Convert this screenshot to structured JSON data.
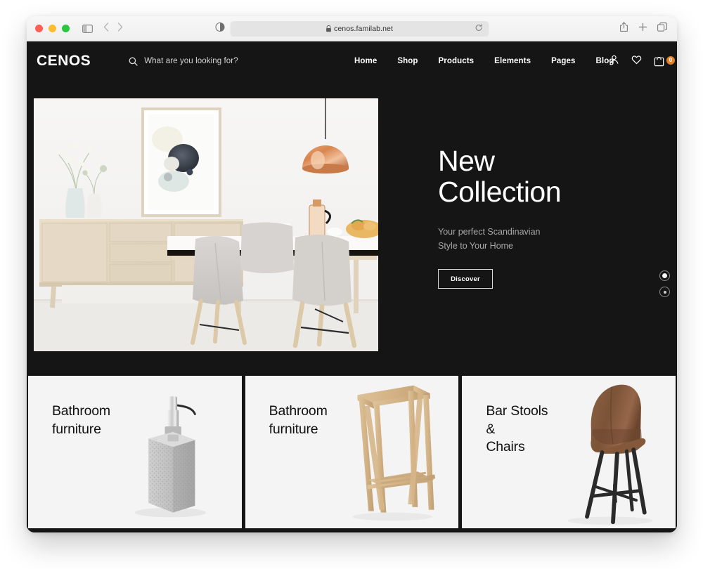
{
  "browser": {
    "url": "cenos.familab.net",
    "lock_icon": "lock-icon",
    "reload_icon": "reload-icon",
    "sidebar_icon": "sidebar-toggle-icon",
    "back_icon": "back-chevron-icon",
    "forward_icon": "forward-chevron-icon",
    "reader_icon": "reader-mode-icon",
    "share_icon": "share-icon",
    "newtab_icon": "plus-icon",
    "tabs_icon": "tab-overview-icon"
  },
  "site": {
    "logo": "CENOS",
    "search": {
      "placeholder": "What are you looking for?",
      "icon": "search-icon"
    },
    "nav": [
      {
        "label": "Home"
      },
      {
        "label": "Shop"
      },
      {
        "label": "Products"
      },
      {
        "label": "Elements"
      },
      {
        "label": "Pages"
      },
      {
        "label": "Blog"
      }
    ],
    "header_icons": {
      "account": "user-icon",
      "wishlist": "heart-icon",
      "cart": "shopping-bag-icon",
      "cart_count": "0",
      "badge_color": "#e0822b"
    },
    "hero": {
      "title_line1": "New",
      "title_line2": "Collection",
      "subtitle_line1": "Your perfect Scandinavian",
      "subtitle_line2": "Style to Your Home",
      "button_label": "Discover",
      "slides": [
        {
          "active": true
        },
        {
          "active": false
        }
      ]
    },
    "cards": [
      {
        "title": "Bathroom\nfurniture",
        "art": "soap-dispenser"
      },
      {
        "title": "Bathroom\nfurniture",
        "art": "wooden-stand"
      },
      {
        "title": "Bar Stools\n&\nChairs",
        "art": "bar-stool"
      }
    ]
  }
}
